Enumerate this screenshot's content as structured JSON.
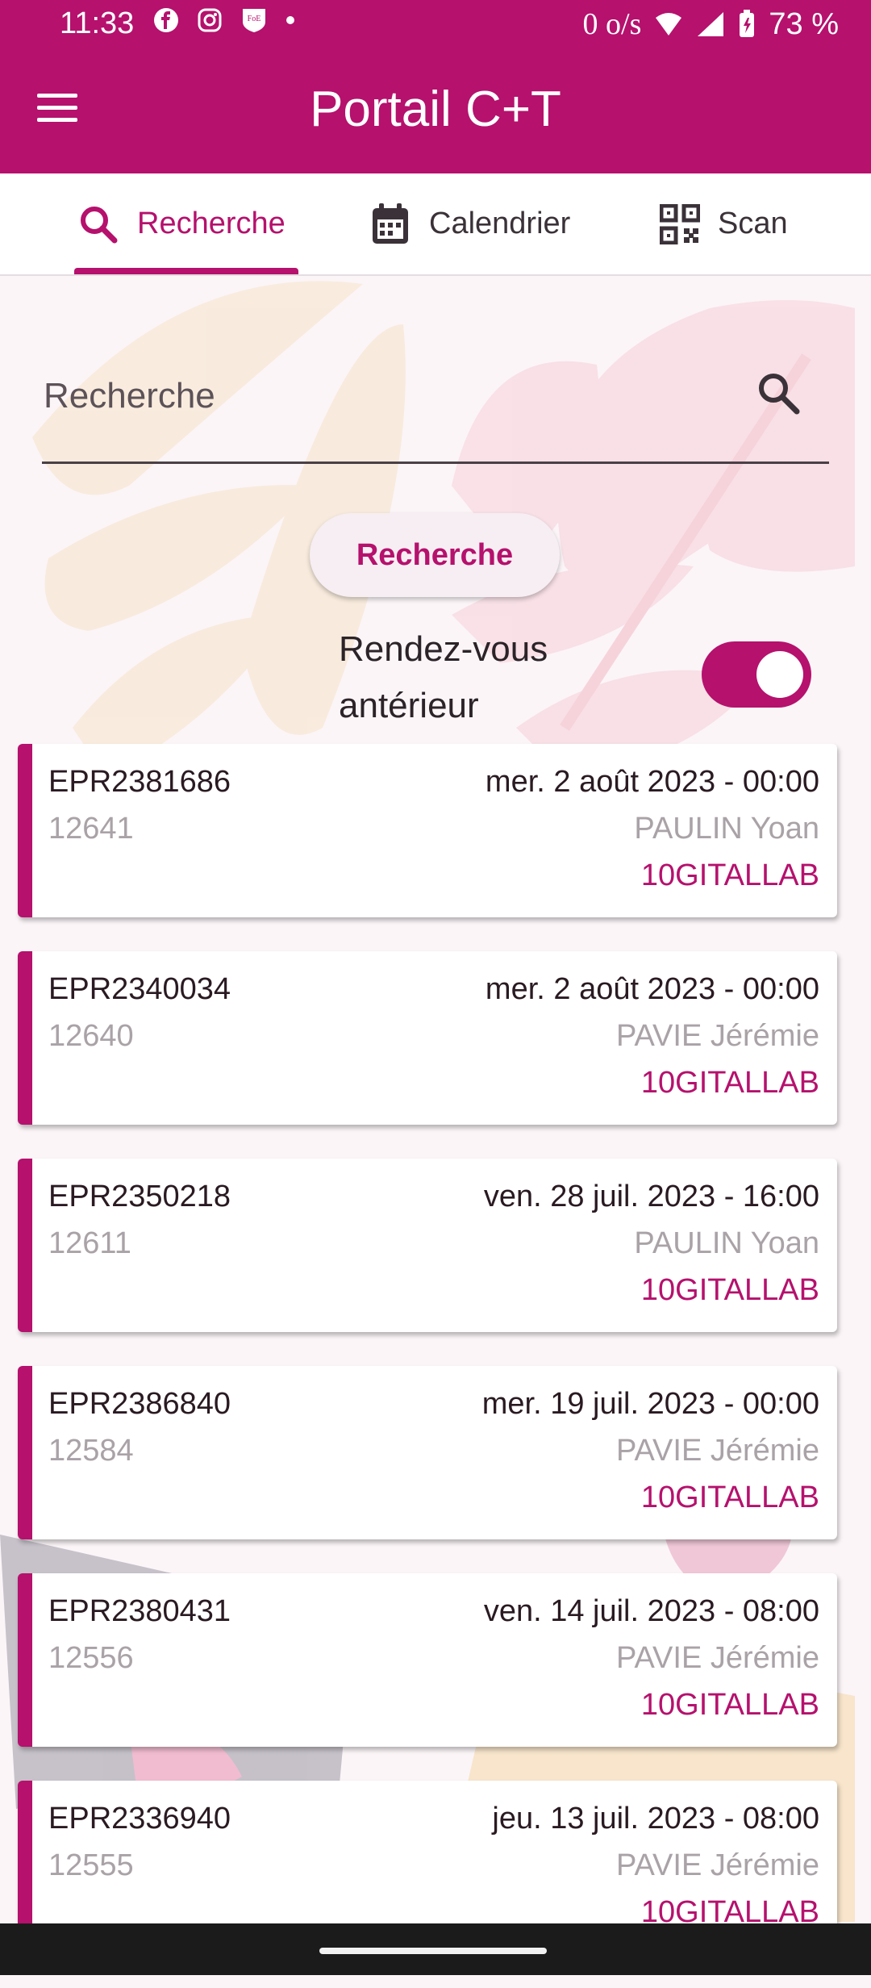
{
  "status_bar": {
    "time": "11:33",
    "network_speed": "0 o/s",
    "battery": "73 %"
  },
  "app": {
    "title": "Portail C+T"
  },
  "tabs": [
    {
      "label": "Recherche",
      "icon": "search-icon",
      "active": true
    },
    {
      "label": "Calendrier",
      "icon": "calendar-icon",
      "active": false
    },
    {
      "label": "Scan",
      "icon": "qr-code-icon",
      "active": false
    }
  ],
  "search": {
    "placeholder": "Recherche",
    "button_label": "Recherche"
  },
  "toggle": {
    "label_line1": "Rendez-vous",
    "label_line2": "antérieur",
    "checked": true
  },
  "appointments": [
    {
      "id": "EPR2381686",
      "number": "12641",
      "date": "mer. 2 août 2023 - 00:00",
      "person": "PAULIN Yoan",
      "lab": "10GITALLAB"
    },
    {
      "id": "EPR2340034",
      "number": "12640",
      "date": "mer. 2 août 2023 - 00:00",
      "person": "PAVIE Jérémie",
      "lab": "10GITALLAB"
    },
    {
      "id": "EPR2350218",
      "number": "12611",
      "date": "ven. 28 juil. 2023 - 16:00",
      "person": "PAULIN Yoan",
      "lab": "10GITALLAB"
    },
    {
      "id": "EPR2386840",
      "number": "12584",
      "date": "mer. 19 juil. 2023 - 00:00",
      "person": "PAVIE Jérémie",
      "lab": "10GITALLAB"
    },
    {
      "id": "EPR2380431",
      "number": "12556",
      "date": "ven. 14 juil. 2023 - 08:00",
      "person": "PAVIE Jérémie",
      "lab": "10GITALLAB"
    },
    {
      "id": "EPR2336940",
      "number": "12555",
      "date": "jeu. 13 juil. 2023 - 08:00",
      "person": "PAVIE Jérémie",
      "lab": "10GITALLAB"
    }
  ],
  "colors": {
    "primary": "#b5116d",
    "background": "#fbf5f8"
  }
}
